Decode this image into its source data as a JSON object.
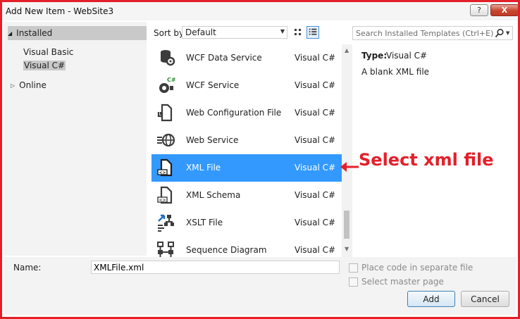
{
  "window": {
    "title": "Add New Item - WebSite3",
    "help_glyph": "?",
    "close_glyph": "X"
  },
  "tree": {
    "installed": "Installed",
    "visual_basic": "Visual Basic",
    "visual_csharp": "Visual C#",
    "online": "Online"
  },
  "toolbar": {
    "sort_label": "Sort by:",
    "sort_value": "Default"
  },
  "search": {
    "placeholder": "Search Installed Templates (Ctrl+E)"
  },
  "templates": [
    {
      "name": "WCF Data Service",
      "language": "Visual C#",
      "icon": "wcf-data-service-icon",
      "selected": false
    },
    {
      "name": "WCF Service",
      "language": "Visual C#",
      "icon": "wcf-service-icon",
      "selected": false
    },
    {
      "name": "Web Configuration File",
      "language": "Visual C#",
      "icon": "web-config-icon",
      "selected": false
    },
    {
      "name": "Web Service",
      "language": "Visual C#",
      "icon": "web-service-icon",
      "selected": false
    },
    {
      "name": "XML File",
      "language": "Visual C#",
      "icon": "xml-file-icon",
      "selected": true
    },
    {
      "name": "XML Schema",
      "language": "Visual C#",
      "icon": "xml-schema-icon",
      "selected": false
    },
    {
      "name": "XSLT File",
      "language": "Visual C#",
      "icon": "xslt-file-icon",
      "selected": false
    },
    {
      "name": "Sequence Diagram",
      "language": "Visual C#",
      "icon": "sequence-diagram-icon",
      "selected": false
    }
  ],
  "details": {
    "type_label": "Type:",
    "type_value": "Visual C#",
    "description": "A blank XML file"
  },
  "annotation": {
    "text": "Select xml file",
    "color": "#e3202a"
  },
  "form": {
    "name_label": "Name:",
    "name_value": "XMLFile.xml",
    "separate_file_label": "Place code in separate file",
    "master_page_label": "Select master page",
    "add_label": "Add",
    "cancel_label": "Cancel"
  },
  "colors": {
    "selection": "#3399ff",
    "frame": "#e3202a"
  }
}
